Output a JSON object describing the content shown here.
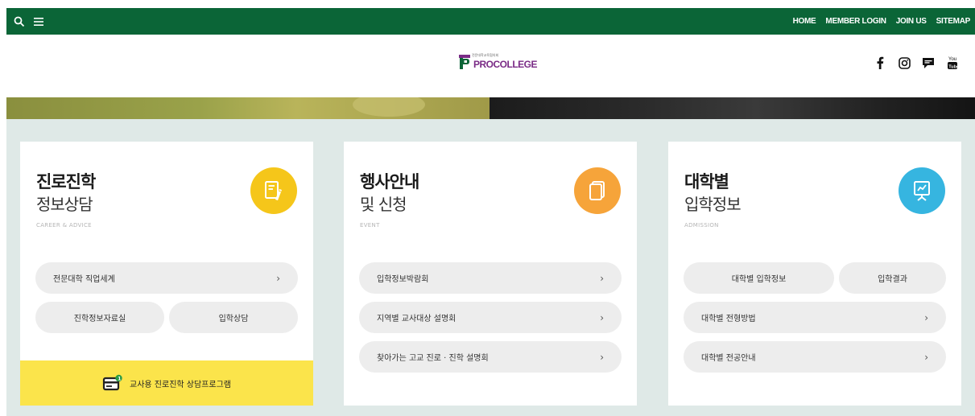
{
  "topbar": {
    "nav": [
      "HOME",
      "MEMBER LOGIN",
      "JOIN US",
      "SITEMAP"
    ],
    "bg_color": "#0b6537"
  },
  "header": {
    "logo": {
      "tagline": "전문대학교육협의회",
      "word": "PROCOLLEGE"
    },
    "social": [
      "facebook-icon",
      "instagram-icon",
      "chat-icon",
      "youtube-icon"
    ]
  },
  "cards": [
    {
      "title1": "진로진학",
      "title2": "정보상담",
      "sub": "CAREER & ADVICE",
      "badge_color": "#f5c61a",
      "items": [
        {
          "label": "전문대학 직업세계"
        },
        {
          "label": "진학정보자료실"
        },
        {
          "label": "입학상담"
        }
      ],
      "footer": "교사용 진로진학 상담프로그램"
    },
    {
      "title1": "행사안내",
      "title2": "및 신청",
      "sub": "EVENT",
      "badge_color": "#f6a43a",
      "items": [
        {
          "label": "입학정보박람회"
        },
        {
          "label": "지역별 교사대상 설명회"
        },
        {
          "label": "찾아가는 고교 진로 · 진학 설명회"
        }
      ]
    },
    {
      "title1": "대학별",
      "title2": "입학정보",
      "sub": "ADMISSION",
      "badge_color": "#36b5e0",
      "items": [
        {
          "label": "대학별 입학정보"
        },
        {
          "label": "입학결과"
        },
        {
          "label": "대학별 전형방법"
        },
        {
          "label": "대학별 전공안내"
        }
      ]
    }
  ],
  "chevron": "›"
}
